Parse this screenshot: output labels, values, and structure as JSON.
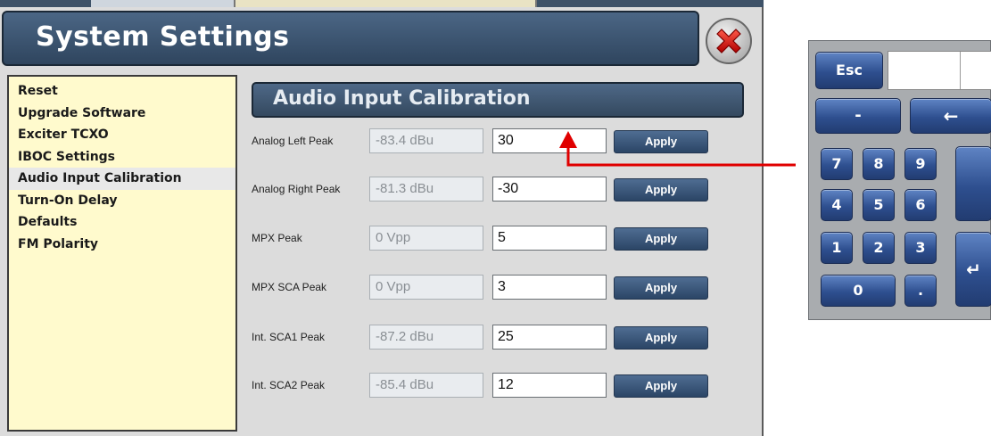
{
  "window": {
    "title": "System Settings"
  },
  "menu": {
    "items": [
      {
        "label": "Reset"
      },
      {
        "label": "Upgrade Software"
      },
      {
        "label": "Exciter TCXO"
      },
      {
        "label": "IBOC Settings"
      },
      {
        "label": "Audio Input Calibration",
        "active": true
      },
      {
        "label": "Turn-On Delay"
      },
      {
        "label": "Defaults"
      },
      {
        "label": "FM Polarity"
      }
    ]
  },
  "panel": {
    "header": "Audio Input Calibration",
    "rows": [
      {
        "label": "Analog Left Peak",
        "measured": "-83.4 dBu",
        "value": "30",
        "apply": "Apply"
      },
      {
        "label": "Analog Right Peak",
        "measured": "-81.3 dBu",
        "value": "-30",
        "apply": "Apply"
      },
      {
        "label": "MPX Peak",
        "measured": "0 Vpp",
        "value": "5",
        "apply": "Apply"
      },
      {
        "label": "MPX SCA Peak",
        "measured": "0 Vpp",
        "value": "3",
        "apply": "Apply"
      },
      {
        "label": "Int. SCA1 Peak",
        "measured": "-87.2 dBu",
        "value": "25",
        "apply": "Apply"
      },
      {
        "label": "Int. SCA2 Peak",
        "measured": "-85.4 dBu",
        "value": "12",
        "apply": "Apply",
        "selected": true
      }
    ]
  },
  "keypad": {
    "esc": "Esc",
    "minus": "-",
    "backspace": "←",
    "digits": [
      "7",
      "8",
      "9",
      "4",
      "5",
      "6",
      "1",
      "2",
      "3"
    ],
    "zero": "0",
    "dot": ".",
    "enter": "↵",
    "display": ""
  },
  "colors": {
    "title_bar": "#3a5270",
    "menu_bg": "#fffacd",
    "apply_button": "#3b5a80",
    "keypad_key": "#2e4f8f",
    "annotation_arrow": "#e00000"
  }
}
